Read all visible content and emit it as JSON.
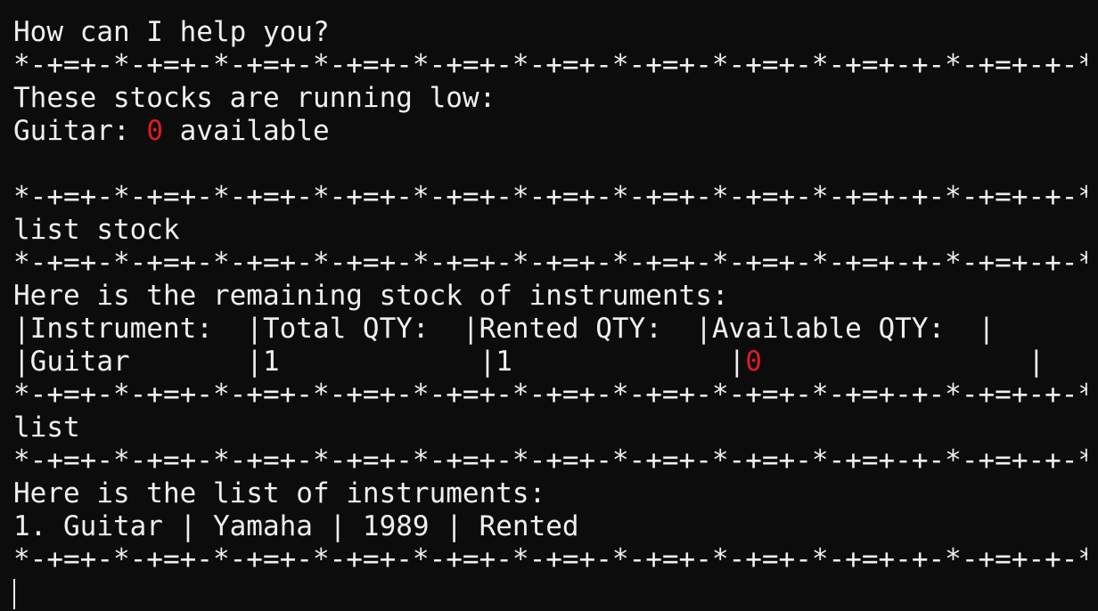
{
  "separator": "*-+=+-*-+=+-*-+=+-*-+=+-*-+=+-*-+=+-*-+=+-*-+=+-*-+=+-+-*-+=+-+-*-+",
  "prompt": "How can I help you?",
  "low_stock": {
    "header": "These stocks are running low:",
    "item_name": "Guitar:",
    "item_count": "0",
    "item_suffix": "available"
  },
  "commands": {
    "list_stock": "list stock",
    "list": "list"
  },
  "stock_table": {
    "intro": "Here is the remaining stock of instruments:",
    "header_row": "|Instrument:  |Total QTY:  |Rented QTY:  |Available QTY:  |",
    "row_prefix": "|Guitar       |1            |1             |",
    "row_available": "0",
    "row_suffix": "                |"
  },
  "instrument_list": {
    "intro": "Here is the list of instruments:",
    "items": [
      "1. Guitar | Yamaha | 1989 | Rented"
    ]
  }
}
